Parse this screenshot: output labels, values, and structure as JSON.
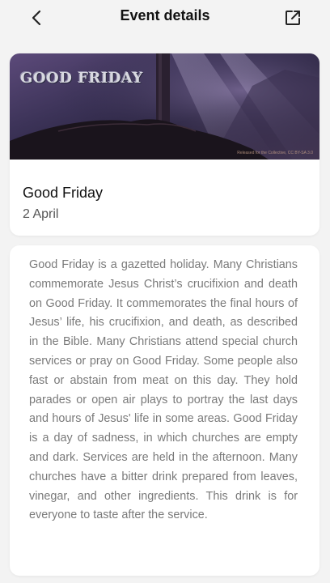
{
  "header": {
    "title": "Event details",
    "back_icon": "chevron-left-icon",
    "share_icon": "external-link-icon"
  },
  "event": {
    "banner_text": "GOOD FRIDAY",
    "banner_credit": "Released for the Collective, CC BY-SA 3.0",
    "name": "Good Friday",
    "date": "2 April"
  },
  "description": "Good Friday is a gazetted holiday. Many Christians commemorate Jesus Christ’s crucifixion and death on Good Friday. It commemorates the final hours of Jesus’ life, his crucifixion, and death, as described in the Bible. Many Christians attend special church services or pray on Good Friday. Some people also fast or abstain from meat on this day. They hold parades or open air plays to portray the last days and hours of Jesus' life in some areas. Good Friday is a day of sadness, in which churches are empty and dark. Services are held in the afternoon. Many churches have a bitter drink prepared from leaves, vinegar, and other ingredients. This drink is for everyone to taste after the service.",
  "colors": {
    "background": "#f3f3f3",
    "card": "#ffffff",
    "title_text": "#111111",
    "secondary_text": "#555555",
    "description_text": "#7a7a7a"
  }
}
